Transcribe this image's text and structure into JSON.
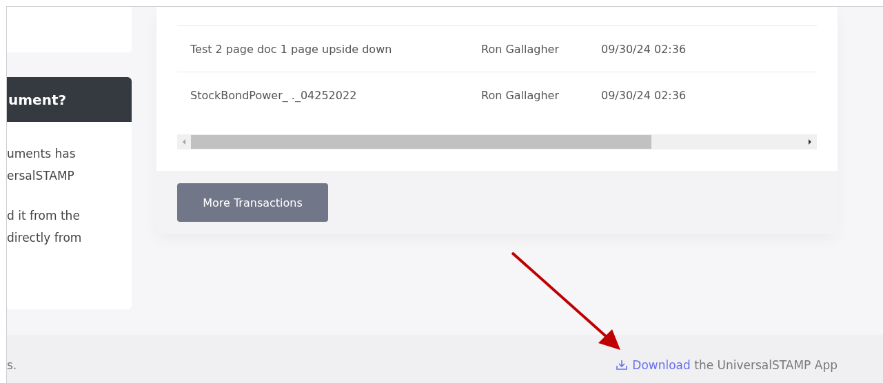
{
  "side_panel": {
    "heading": "ument?",
    "paragraphs": [
      [
        "uments has",
        "ersalSTAMP"
      ],
      [
        "d it from the",
        "directly from"
      ]
    ]
  },
  "table": {
    "rows": [
      {
        "name": "Test 2 page doc 1 page upside down",
        "user": "Ron Gallagher",
        "date": "09/30/24 02:36"
      },
      {
        "name": "StockBondPower_ ._04252022",
        "user": "Ron Gallagher",
        "date": "09/30/24 02:36"
      }
    ]
  },
  "more_button": "More Transactions",
  "footer": {
    "left_text": "s.",
    "download_link": "Download",
    "download_rest": "the UniversalSTAMP App"
  }
}
